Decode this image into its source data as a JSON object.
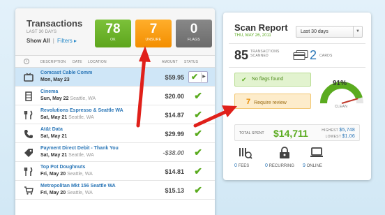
{
  "transactions": {
    "title": "Transactions",
    "subtitle": "LAST 30 DAYS",
    "show_all": "Show All",
    "separator": "|",
    "filters": "Filters ▸",
    "stats": {
      "ok": {
        "value": "78",
        "label": "OK"
      },
      "unsure": {
        "value": "7",
        "label": "UNSURE"
      },
      "flags": {
        "value": "0",
        "label": "FLAGS"
      }
    },
    "columns": {
      "description": "DESCRIPTION",
      "date": "DATE",
      "location": "LOCATION",
      "amount": "AMOUNT",
      "status": "STATUS"
    },
    "rows": [
      {
        "icon": "tv-icon",
        "name": "Comcast Cable Comm",
        "date": "Mon, May 23",
        "location": "",
        "amount": "$59.95"
      },
      {
        "icon": "film-icon",
        "name": "Cinema",
        "date": "Sun, May 22",
        "location": "Seattle, WA",
        "amount": "$20.00"
      },
      {
        "icon": "fork-knife-icon",
        "name": "Revolutions Espresso & Seattle WA",
        "date": "Sat, May 21",
        "location": "Seattle, WA",
        "amount": "$14.87"
      },
      {
        "icon": "phone-icon",
        "name": "At&t Data",
        "date": "Sat, May 21",
        "location": "",
        "amount": "$29.99"
      },
      {
        "icon": "tag-icon",
        "name": "Payment Direct Debit - Thank You",
        "date": "Sat, May 21",
        "location": "Seattle, WA",
        "amount": "-$38.00"
      },
      {
        "icon": "fork-knife-icon",
        "name": "Top Pot Doughnuts",
        "date": "Fri, May 20",
        "location": "Seattle, WA",
        "amount": "$14.81"
      },
      {
        "icon": "cart-icon",
        "name": "Metropolitan Mkt 156 Seattle WA",
        "date": "Fri, May 20",
        "location": "Seattle, WA",
        "amount": "$15.13"
      }
    ]
  },
  "scan_report": {
    "title": "Scan Report",
    "date": "THU, MAY 26, 2011",
    "range_select": "Last 30 days",
    "transactions_count": "85",
    "transactions_label_1": "TRANSACTIONS",
    "transactions_label_2": "SCANNED",
    "cards_count": "2",
    "cards_label": "CARDS",
    "no_flags": "No flags found",
    "review_count": "7",
    "review_label": "Require review",
    "gauge_percent": "91%",
    "gauge_value": 0.91,
    "gauge_label": "CLEAN",
    "total_label": "TOTAL SPENT",
    "total_value": "$14,711",
    "highest_label": "HIGHEST",
    "highest_value": "$5,748",
    "lowest_label": "LOWEST",
    "lowest_value": "$1.06",
    "fees_count": "0",
    "fees_label": "FEES",
    "recurring_count": "0",
    "recurring_label": "RECURRING",
    "online_count": "9",
    "online_label": "ONLINE"
  },
  "colors": {
    "ok": "#5da51d",
    "unsure": "#f38e00",
    "flags": "#6b6b6b",
    "link": "#2a76b7",
    "arrow": "#e0201a"
  }
}
